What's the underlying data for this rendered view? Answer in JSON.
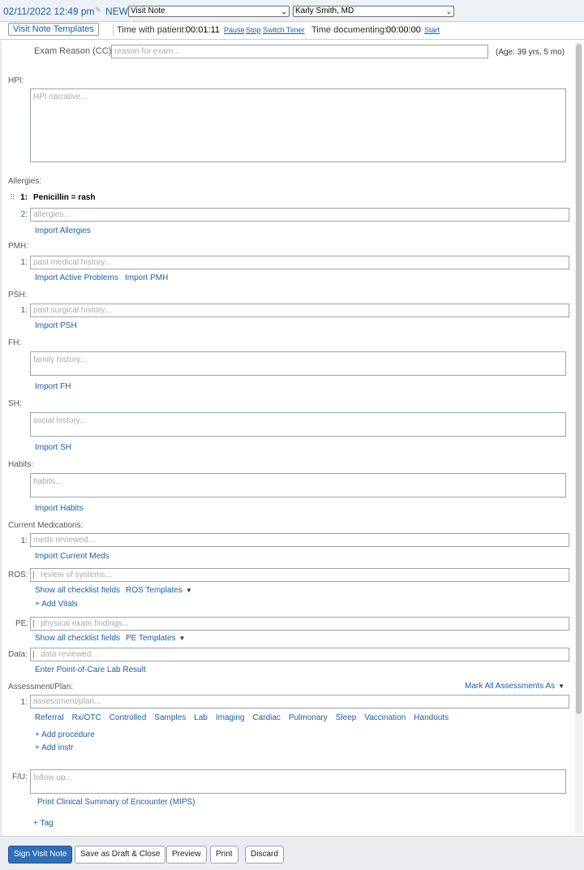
{
  "header": {
    "datetime": "02/11/2022 12:49 pm",
    "new_badge": "NEW",
    "note_type": "Visit Note",
    "provider": "Karly Smith, MD"
  },
  "subbar": {
    "templates_button": "Visit Note Templates",
    "time_with_patient_label": "Time with patient:",
    "time_with_patient_value": "00:01:11",
    "pause": "Pause",
    "stop": "Stop",
    "switch_timer": "Switch Timer",
    "time_documenting_label": "Time documenting:",
    "time_documenting_value": "00:00:00",
    "start": "Start"
  },
  "exam_reason": {
    "label": "Exam Reason (CC):",
    "placeholder": "reason for exam...",
    "age": "(Age: 39 yrs, 5 mo)"
  },
  "hpi": {
    "label": "HPI:",
    "placeholder": "HPI narrative..."
  },
  "allergies": {
    "label": "Allergies:",
    "items": [
      {
        "num": "1:",
        "text": "Penicillin = rash"
      }
    ],
    "new_num": "2:",
    "placeholder": "allergies...",
    "import_link": "Import Allergies"
  },
  "pmh": {
    "label": "PMH:",
    "num": "1:",
    "placeholder": "past medical history...",
    "link_active": "Import Active Problems",
    "link_pmh": "Import PMH"
  },
  "psh": {
    "label": "PSH:",
    "num": "1:",
    "placeholder": "past surgical history...",
    "import_link": "Import PSH"
  },
  "fh": {
    "label": "FH:",
    "placeholder": "family history...",
    "import_link": "Import FH"
  },
  "sh": {
    "label": "SH:",
    "placeholder": "social history...",
    "import_link": "Import SH"
  },
  "habits": {
    "label": "Habits:",
    "placeholder": "habits...",
    "import_link": "Import Habits"
  },
  "meds": {
    "label": "Current Medications:",
    "num": "1:",
    "placeholder": "meds reviewed...",
    "import_link": "Import Current Meds"
  },
  "ros": {
    "label": "ROS:",
    "placeholder": "review of systems...",
    "show_all": "Show all checklist fields",
    "templates": "ROS Templates",
    "add_vitals": "+ Add Vitals"
  },
  "pe": {
    "label": "PE:",
    "placeholder": "physical exam findings...",
    "show_all": "Show all checklist fields",
    "templates": "PE Templates"
  },
  "data_section": {
    "label": "Data:",
    "placeholder": "data reviewed...",
    "lab_link": "Enter Point-of-Care Lab Result"
  },
  "assessment": {
    "label": "Assessment/Plan:",
    "mark_all": "Mark All Assessments As",
    "num": "1:",
    "placeholder": "assessment/plan...",
    "orders": [
      "Referral",
      "Rx/OTC",
      "Controlled",
      "Samples",
      "Lab",
      "Imaging",
      "Cardiac",
      "Pulmonary",
      "Sleep",
      "Vaccination",
      "Handouts"
    ],
    "add_procedure": "+ Add procedure",
    "add_instr": "+ Add instr"
  },
  "followup": {
    "label": "F/U:",
    "placeholder": "follow up...",
    "print_link": "Print Clinical Summary of Encounter (MIPS)",
    "add_tag": "+ Tag"
  },
  "footer": {
    "sign": "Sign Visit Note",
    "save_draft": "Save as Draft & Close",
    "preview": "Preview",
    "print": "Print",
    "discard": "Discard"
  }
}
